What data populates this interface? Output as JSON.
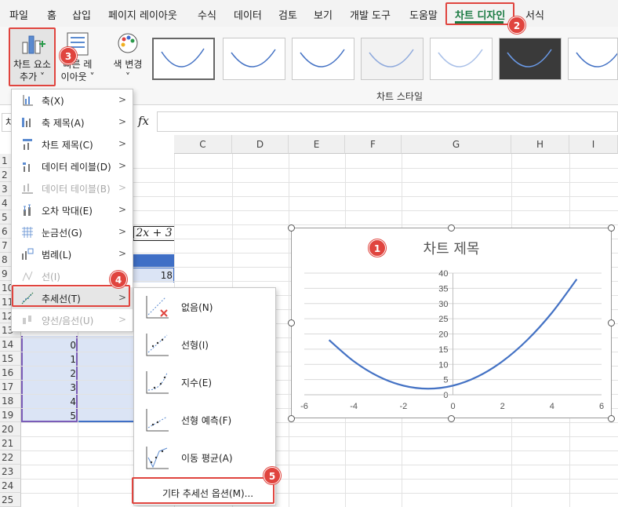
{
  "ribbon_tabs": [
    "파일",
    "홈",
    "삽입",
    "페이지 레이아웃",
    "수식",
    "데이터",
    "검토",
    "보기",
    "개발 도구",
    "도움말",
    "차트 디자인",
    "서식"
  ],
  "active_tab": "차트 디자인",
  "ribbon": {
    "add_element_line1": "차트 요소",
    "add_element_line2": "추가 ˅",
    "quick_layout_line1": "빠른 레",
    "quick_layout_line2": "이아웃 ˅",
    "change_color_line1": "색 변경",
    "change_color_line2": "˅",
    "chart_styles_group": "차트 스타일"
  },
  "formula_bar": {
    "fx": "fx",
    "name_box": "차"
  },
  "columns": [
    "C",
    "D",
    "E",
    "F",
    "G",
    "H",
    "I"
  ],
  "rows": [
    "1",
    "2",
    "3",
    "4",
    "5",
    "6",
    "7",
    "8",
    "9",
    "10",
    "11",
    "12",
    "13",
    "14",
    "15",
    "16",
    "17",
    "18",
    "19",
    "20",
    "21",
    "22",
    "23",
    "24",
    "25"
  ],
  "sheet": {
    "formula_cell": "2x + 3",
    "visible_values": [
      {
        "row": "9",
        "value": "18"
      },
      {
        "row": "14",
        "value": "0"
      },
      {
        "row": "15",
        "value": "1"
      },
      {
        "row": "16",
        "value": "2"
      },
      {
        "row": "17",
        "value": "3"
      },
      {
        "row": "18",
        "value": "4"
      },
      {
        "row": "19",
        "value": "5"
      }
    ]
  },
  "chart_menu": {
    "items": [
      {
        "label": "축(X)",
        "enabled": true,
        "submenu": true
      },
      {
        "label": "축 제목(A)",
        "enabled": true,
        "submenu": true
      },
      {
        "label": "차트 제목(C)",
        "enabled": true,
        "submenu": true
      },
      {
        "label": "데이터 레이블(D)",
        "enabled": true,
        "submenu": true
      },
      {
        "label": "데이터 테이블(B)",
        "enabled": false,
        "submenu": true
      },
      {
        "label": "오차 막대(E)",
        "enabled": true,
        "submenu": true
      },
      {
        "label": "눈금선(G)",
        "enabled": true,
        "submenu": true
      },
      {
        "label": "범례(L)",
        "enabled": true,
        "submenu": true
      },
      {
        "label": "선(I)",
        "enabled": false,
        "submenu": false
      },
      {
        "label": "추세선(T)",
        "enabled": true,
        "submenu": true
      },
      {
        "label": "양선/음선(U)",
        "enabled": false,
        "submenu": true
      }
    ]
  },
  "trendline_menu": {
    "items": [
      "없음(N)",
      "선형(I)",
      "지수(E)",
      "선형 예측(F)",
      "이동 평균(A)"
    ],
    "more_options": "기타 추세선 옵션(M)..."
  },
  "callouts": [
    "1",
    "2",
    "3",
    "4",
    "5"
  ],
  "chart_data": {
    "type": "line",
    "title": "차트 제목",
    "x": [
      -5,
      -4,
      -3,
      -2,
      -1,
      0,
      1,
      2,
      3,
      4,
      5
    ],
    "series": [
      {
        "values": [
          18,
          11,
          6,
          3,
          2,
          3,
          6,
          11,
          18,
          27,
          38
        ]
      }
    ],
    "xlim": [
      -6,
      6
    ],
    "ylim": [
      0,
      40
    ],
    "xticks": [
      "-6",
      "-4",
      "-2",
      "0",
      "2",
      "4",
      "6"
    ],
    "yticks": [
      "0",
      "5",
      "10",
      "15",
      "20",
      "25",
      "30",
      "35",
      "40"
    ],
    "grid": true,
    "line_color": "#4472c4"
  },
  "colors": {
    "accent": "#1a7a42",
    "callout": "#e0443e",
    "series": "#4472c4",
    "selected_column": "#3f6fc6"
  }
}
